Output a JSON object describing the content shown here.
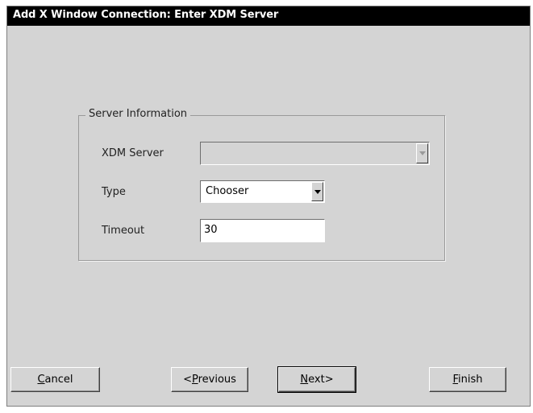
{
  "window": {
    "title": "Add X Window Connection: Enter XDM Server"
  },
  "group": {
    "title": "Server Information"
  },
  "fields": {
    "xdm_server": {
      "label": "XDM Server",
      "value": ""
    },
    "type": {
      "label": "Type",
      "value": "Chooser"
    },
    "timeout": {
      "label": "Timeout",
      "value": "30"
    }
  },
  "buttons": {
    "cancel": {
      "mnemonic": "C",
      "rest": "ancel"
    },
    "previous": {
      "prefix": "<",
      "mnemonic": "P",
      "rest": "revious"
    },
    "next": {
      "mnemonic": "N",
      "rest": "ext>"
    },
    "finish": {
      "mnemonic": "F",
      "rest": "inish"
    }
  }
}
